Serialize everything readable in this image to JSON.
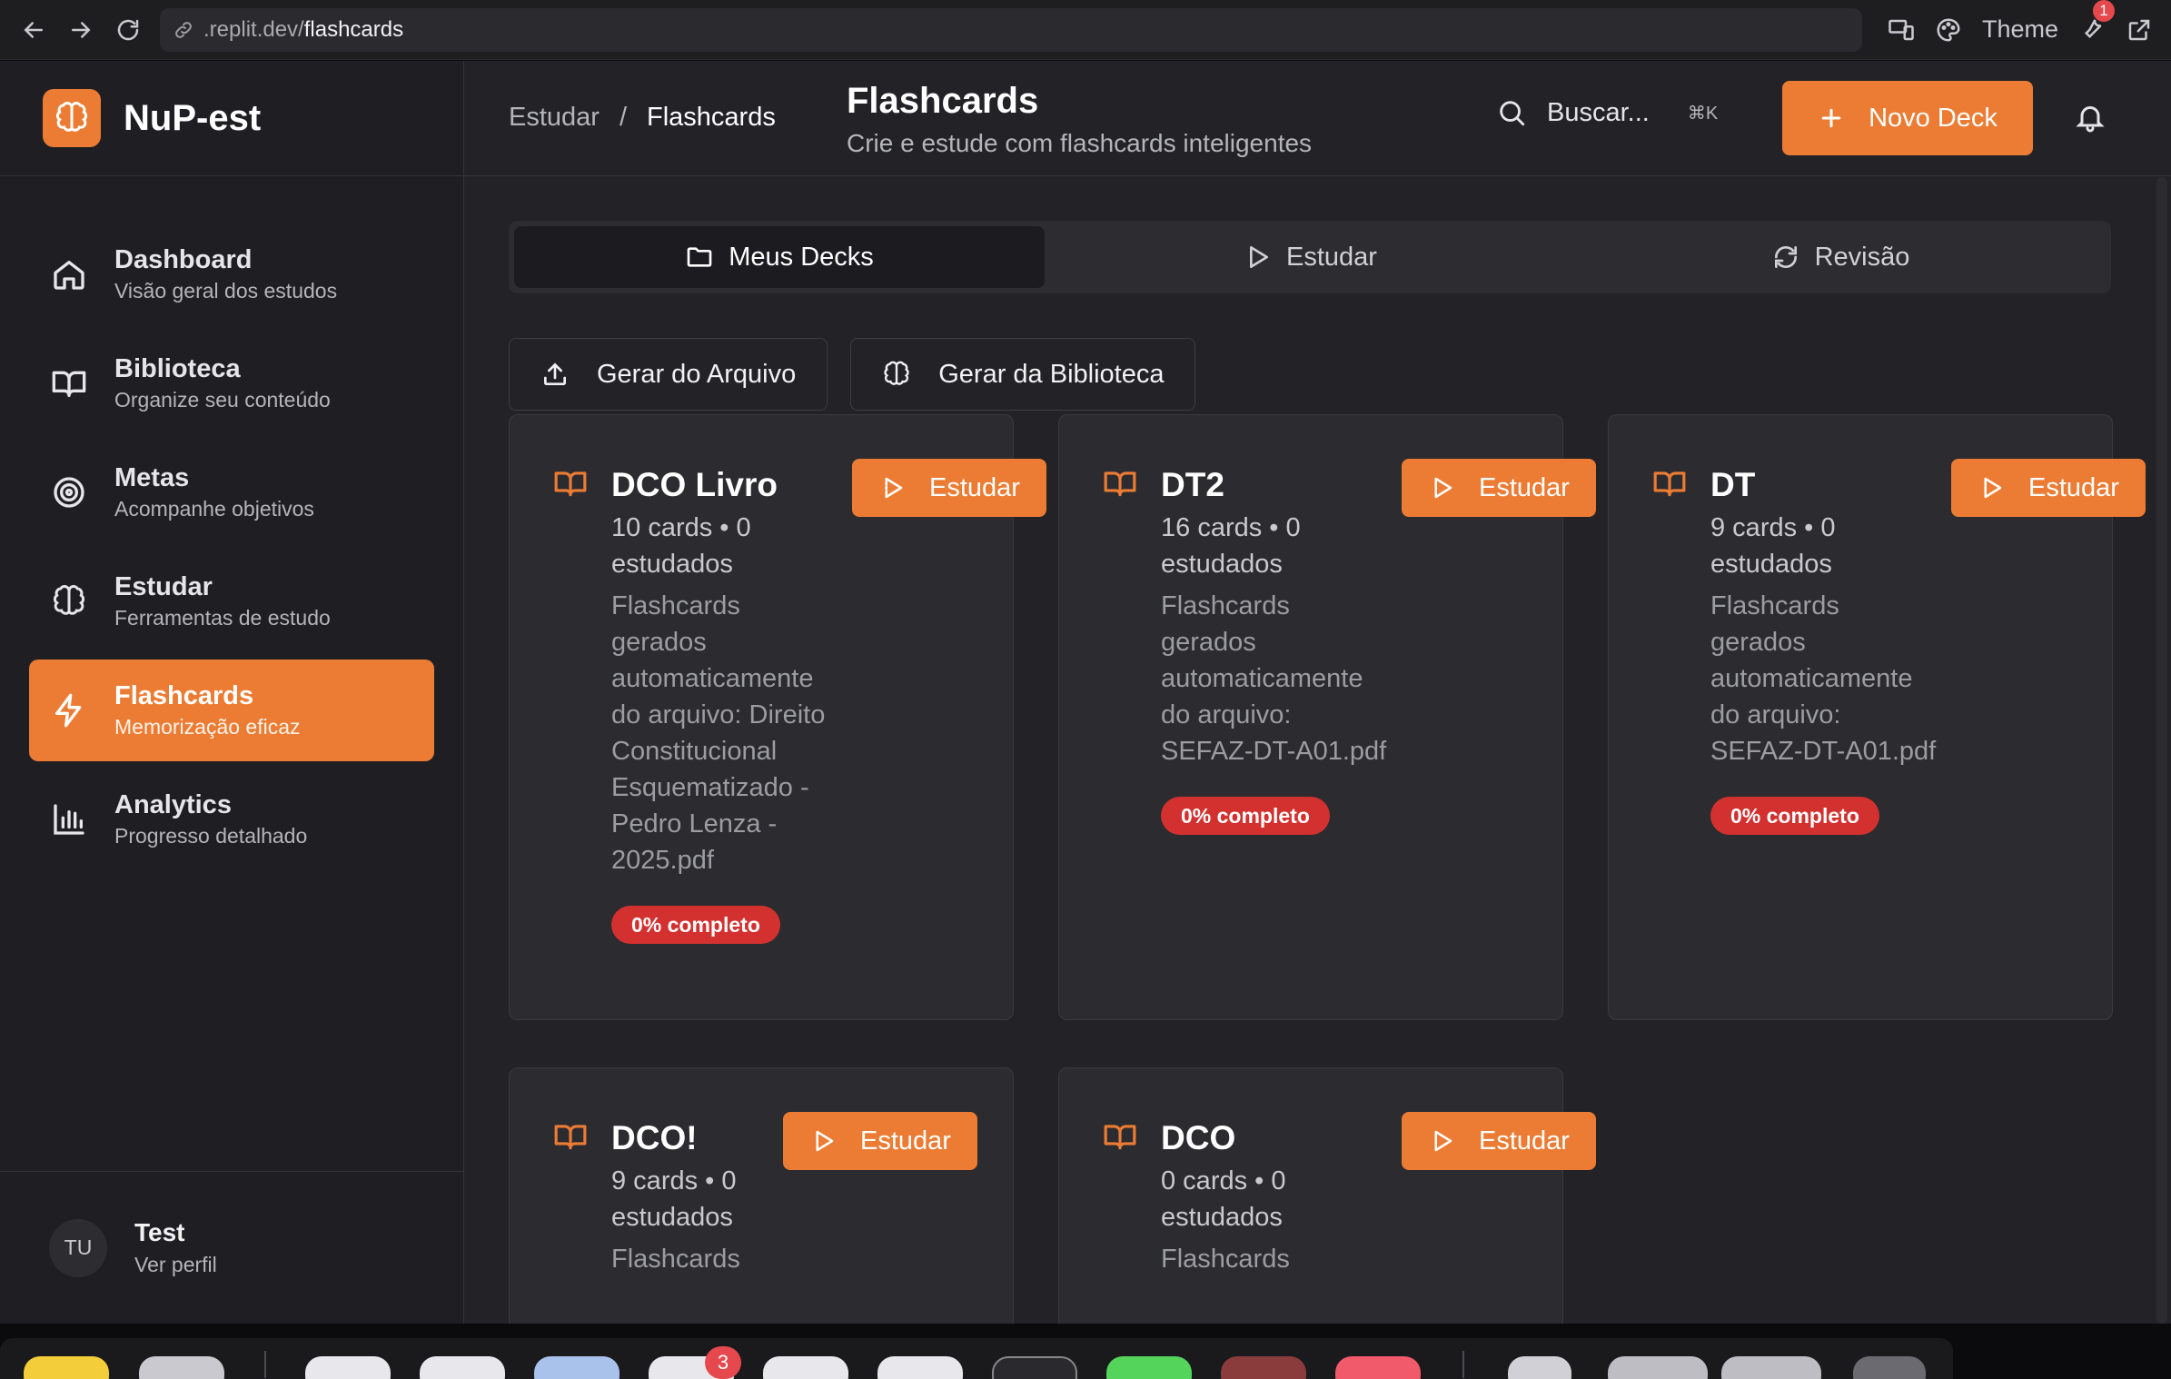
{
  "browser": {
    "url_prefix": ".replit.dev/",
    "url_path": "flashcards",
    "theme_label": "Theme",
    "notification_count": "1"
  },
  "app": {
    "name": "NuP-est"
  },
  "sidebar": {
    "items": [
      {
        "title": "Dashboard",
        "subtitle": "Visão geral dos estudos",
        "icon": "home-icon",
        "active": false
      },
      {
        "title": "Biblioteca",
        "subtitle": "Organize seu conteúdo",
        "icon": "book-open-icon",
        "active": false
      },
      {
        "title": "Metas",
        "subtitle": "Acompanhe objetivos",
        "icon": "target-icon",
        "active": false
      },
      {
        "title": "Estudar",
        "subtitle": "Ferramentas de estudo",
        "icon": "brain-icon",
        "active": false
      },
      {
        "title": "Flashcards",
        "subtitle": "Memorização eficaz",
        "icon": "lightning-icon",
        "active": true
      },
      {
        "title": "Analytics",
        "subtitle": "Progresso detalhado",
        "icon": "bar-chart-icon",
        "active": false
      }
    ],
    "profile": {
      "initials": "TU",
      "name": "Test",
      "subtitle": "Ver perfil"
    }
  },
  "header": {
    "breadcrumb": {
      "parent": "Estudar",
      "separator": "/",
      "current": "Flashcards"
    },
    "title": "Flashcards",
    "subtitle": "Crie e estude com flashcards inteligentes",
    "search_label": "Buscar...",
    "search_shortcut": "⌘K",
    "new_deck_label": "Novo Deck"
  },
  "tabs": [
    {
      "label": "Meus Decks",
      "icon": "folder-icon",
      "active": true
    },
    {
      "label": "Estudar",
      "icon": "play-icon",
      "active": false
    },
    {
      "label": "Revisão",
      "icon": "refresh-icon",
      "active": false
    }
  ],
  "generate": {
    "from_file_label": "Gerar do Arquivo",
    "from_library_label": "Gerar da Biblioteca"
  },
  "decks": [
    {
      "title": "DCO Livro",
      "meta": "10 cards • 0 estudados",
      "description": "Flashcards gerados automaticamente do arquivo: Direito Constitucional Esquematizado - Pedro Lenza - 2025.pdf",
      "progress_label": "0% completo",
      "progress": 0,
      "study_label": "Estudar"
    },
    {
      "title": "DT2",
      "meta": "16 cards • 0 estudados",
      "description": "Flashcards gerados automaticamente do arquivo: SEFAZ-DT-A01.pdf",
      "progress_label": "0% completo",
      "progress": 0,
      "study_label": "Estudar"
    },
    {
      "title": "DT",
      "meta": "9 cards • 0 estudados",
      "description": "Flashcards gerados automaticamente do arquivo: SEFAZ-DT-A01.pdf",
      "progress_label": "0% completo",
      "progress": 0,
      "study_label": "Estudar"
    },
    {
      "title": "DCO!",
      "meta": "9 cards • 0 estudados",
      "description": "Flashcards",
      "progress_label": "",
      "study_label": "Estudar"
    },
    {
      "title": "DCO",
      "meta": "0 cards • 0 estudados",
      "description": "Flashcards",
      "progress_label": "",
      "study_label": "Estudar"
    }
  ],
  "dock": {
    "badge_count": "3"
  }
}
